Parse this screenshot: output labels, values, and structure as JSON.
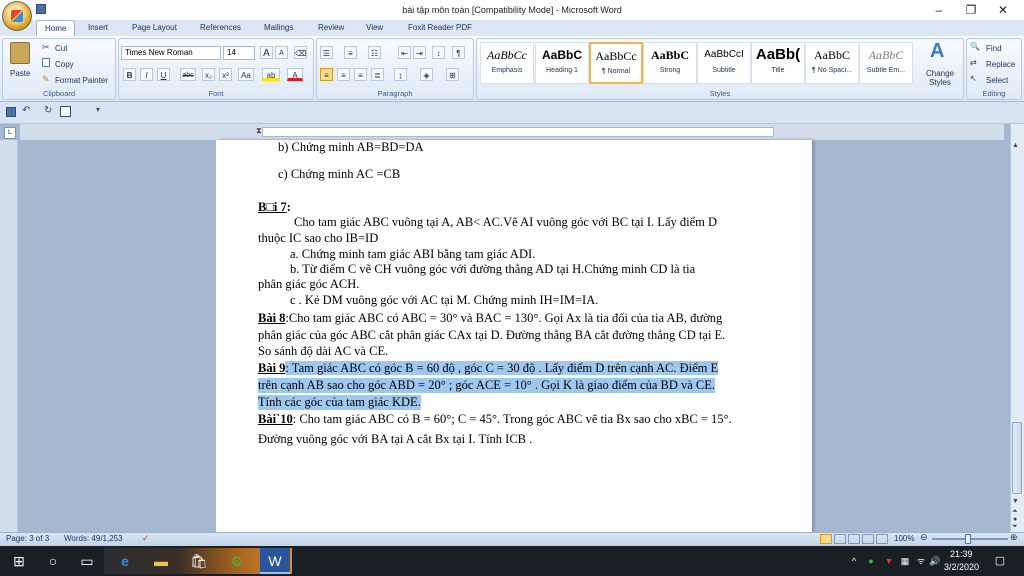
{
  "window": {
    "title": "bài tập môn toán [Compatibility Mode] - Microsoft Word",
    "minimize": "–",
    "restore": "❐",
    "close": "✕"
  },
  "tabs": [
    "Home",
    "Insert",
    "Page Layout",
    "References",
    "Mailings",
    "Review",
    "View",
    "Foxit Reader PDF"
  ],
  "clipboard": {
    "paste": "Paste",
    "cut": "Cut",
    "copy": "Copy",
    "format_painter": "Format Painter",
    "label": "Clipboard"
  },
  "font": {
    "name": "Times New Roman",
    "size": "14",
    "label": "Font",
    "grow": "A",
    "shrink": "A",
    "bold": "B",
    "italic": "I",
    "underline": "U",
    "strike": "abc",
    "sub": "x₂",
    "sup": "x²",
    "case": "Aa",
    "highlight": "ab",
    "color": "A"
  },
  "paragraph": {
    "label": "Paragraph"
  },
  "styles": {
    "label": "Styles",
    "items": [
      {
        "preview": "AaBbCc",
        "name": "Emphasis"
      },
      {
        "preview": "AaBbC",
        "name": "Heading 1"
      },
      {
        "preview": "AaBbCc",
        "name": "¶ Normal"
      },
      {
        "preview": "AaBbC",
        "name": "Strong"
      },
      {
        "preview": "AaBbCcI",
        "name": "Subtitle"
      },
      {
        "preview": "AaBb(",
        "name": "Title"
      },
      {
        "preview": "AaBbC",
        "name": "¶ No Spaci..."
      },
      {
        "preview": "AaBbC",
        "name": "Subtle Em..."
      }
    ],
    "change": "Change Styles"
  },
  "editing": {
    "find": "Find",
    "replace": "Replace",
    "select": "Select",
    "label": "Editing"
  },
  "document": {
    "line_b": "b)  Chứng minh AB=BD=DA",
    "line_c": "c)  Chứng minh AC =CB",
    "bai7_title": "B□i 7",
    "bai7_colon": ":",
    "bai7_l1": "Cho tam giác ABC vuông tại A,  AB< AC.Vẽ AI vuông góc với BC tại I. Lấy điểm D",
    "bai7_l2": "thuộc IC sao cho IB=ID",
    "bai7_a": "a.  Chứng minh tam giác ABI bằng tam giác ADI.",
    "bai7_b": "b.  Từ điểm C vẽ CH vuông góc với đường thẳng AD tại H.Chứng minh CD là             tia",
    "bai7_b2": "phân giác góc ACH.",
    "bai7_c": "c .  Kẻ DM vuông góc với AC tại M. Chứng minh IH=IM=IA.",
    "bai8_title": "Bài 8",
    "bai8_l1": ":Cho tam giác ABC có  ABC = 30° và  BAC = 130°. Gọi Ax là tia đối của tia AB, đường",
    "bai8_l2": "phân giác của góc  ABC  cắt phân giác  CAx  tại D. Đường thẳng BA cắt đường thẳng CD tại E.",
    "bai8_l3": "So sánh độ dài AC và CE.",
    "bai9_title": "Bài 9",
    "bai9_l1": ": Tam giác ABC có góc B = 60 độ , góc C = 30 độ . Lấy điểm D trên cạnh AC. Điểm E",
    "bai9_l2": "trên cạnh AB sao cho góc  ABD = 20°  ; góc  ACE = 10° . Gọi K là giao điểm của BD và CE.",
    "bai9_l3": "Tính các góc của tam giác KDE.",
    "bai10_title": "Bài`10",
    "bai10_l1": ": Cho tam giác ABC có  B = 60°; C = 45°. Trong góc ABC vẽ tia Bx sao cho  xBC = 15°.",
    "bai10_l2": "Đường vuông góc với BA tại A cắt Bx tại I. Tính  ICB ."
  },
  "status": {
    "page": "Page: 3 of 3",
    "words": "Words: 49/1,253",
    "zoom": "100%",
    "zoom_level": 1.0
  },
  "taskbar": {
    "time": "21:39",
    "date": "3/2/2020"
  }
}
